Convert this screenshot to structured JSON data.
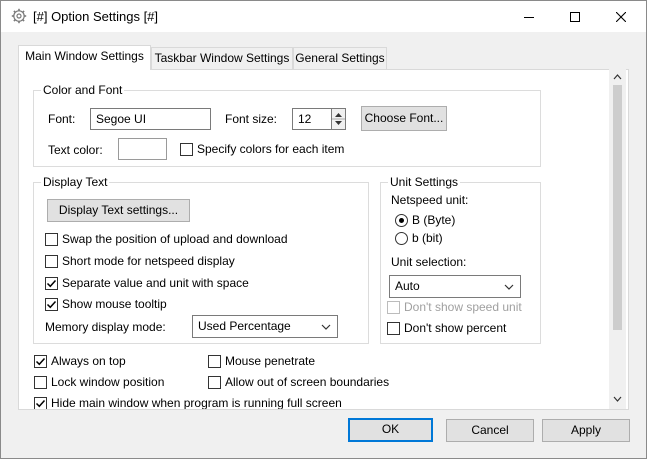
{
  "window": {
    "title": "[#] Option Settings [#]"
  },
  "title_icon": "gear-icon",
  "title_buttons": [
    "minimize-icon",
    "maximize-icon",
    "close-icon"
  ],
  "tabs": [
    {
      "label": "Main Window Settings",
      "active": true
    },
    {
      "label": "Taskbar Window Settings",
      "active": false
    },
    {
      "label": "General Settings",
      "active": false
    }
  ],
  "color_font": {
    "title": "Color and Font",
    "font_label": "Font:",
    "font_value": "Segoe UI",
    "font_size_label": "Font size:",
    "font_size_value": "12",
    "choose_font_label": "Choose Font...",
    "text_color_label": "Text color:",
    "specify_colors_label": "Specify colors for each item",
    "specify_colors_checked": false
  },
  "display_text": {
    "title": "Display Text",
    "settings_button": "Display Text settings...",
    "options": [
      {
        "label": "Swap the position of upload and download",
        "checked": false
      },
      {
        "label": "Short mode for netspeed display",
        "checked": false
      },
      {
        "label": "Separate value and unit with space",
        "checked": true
      },
      {
        "label": "Show mouse tooltip",
        "checked": true
      }
    ],
    "memory_mode_label": "Memory display mode:",
    "memory_mode_value": "Used Percentage"
  },
  "unit_settings": {
    "title": "Unit Settings",
    "netspeed_label": "Netspeed unit:",
    "radio_options": [
      {
        "label": "B (Byte)",
        "selected": true
      },
      {
        "label": "b (bit)",
        "selected": false
      }
    ],
    "unit_selection_label": "Unit selection:",
    "unit_selection_value": "Auto",
    "dont_show_speed_unit": {
      "label": "Don't show speed unit",
      "checked": false,
      "disabled": true
    },
    "dont_show_percent": {
      "label": "Don't show percent",
      "checked": false
    }
  },
  "bottom_options": {
    "always_on_top": {
      "label": "Always on top",
      "checked": true
    },
    "mouse_penetrate": {
      "label": "Mouse penetrate",
      "checked": false
    },
    "lock_window_position": {
      "label": "Lock window position",
      "checked": false
    },
    "allow_out_of_screen": {
      "label": "Allow out of screen boundaries",
      "checked": false
    },
    "hide_main_window": {
      "label": "Hide main window when program is running full screen",
      "checked": true
    }
  },
  "buttons": {
    "ok": "OK",
    "cancel": "Cancel",
    "apply": "Apply"
  },
  "colors": {
    "accent": "#0078d7",
    "window_bg": "#f0f0f0",
    "panel_bg": "#ffffff"
  }
}
